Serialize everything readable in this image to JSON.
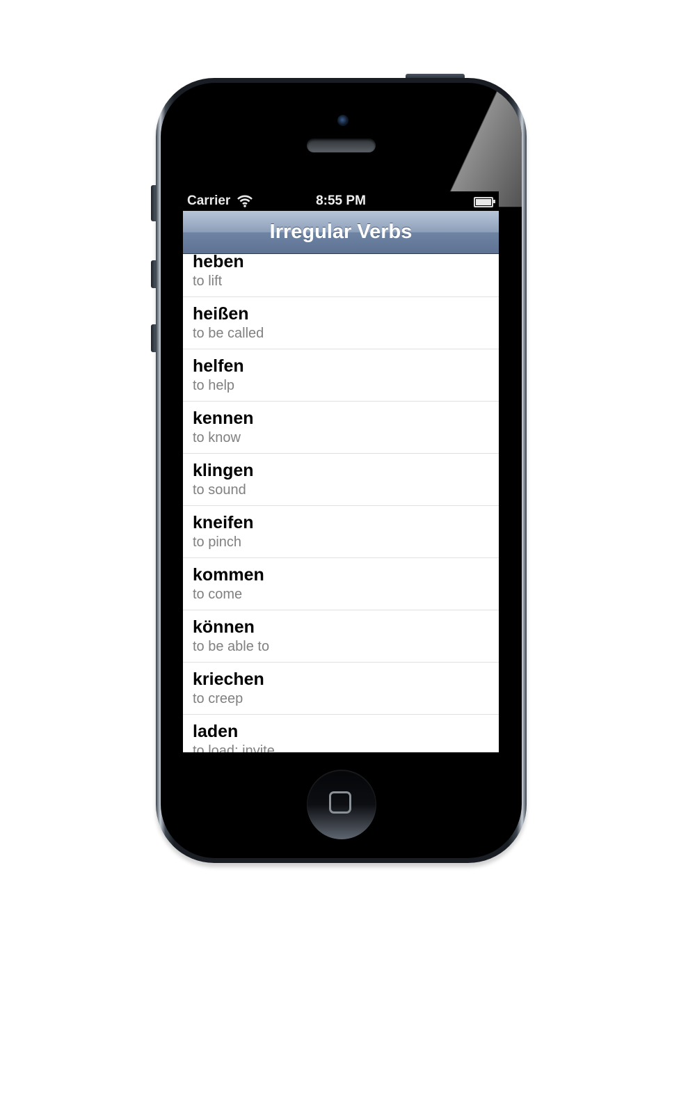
{
  "status_bar": {
    "carrier": "Carrier",
    "time": "8:55 PM"
  },
  "nav": {
    "title": "Irregular Verbs"
  },
  "verbs": [
    {
      "verb": "heben",
      "meaning": "to lift"
    },
    {
      "verb": "heißen",
      "meaning": "to be called"
    },
    {
      "verb": "helfen",
      "meaning": "to help"
    },
    {
      "verb": "kennen",
      "meaning": "to know"
    },
    {
      "verb": "klingen",
      "meaning": "to sound"
    },
    {
      "verb": "kneifen",
      "meaning": "to pinch"
    },
    {
      "verb": "kommen",
      "meaning": "to come"
    },
    {
      "verb": "können",
      "meaning": "to be able to"
    },
    {
      "verb": "kriechen",
      "meaning": "to creep"
    },
    {
      "verb": "laden",
      "meaning": "to load; invite"
    }
  ]
}
